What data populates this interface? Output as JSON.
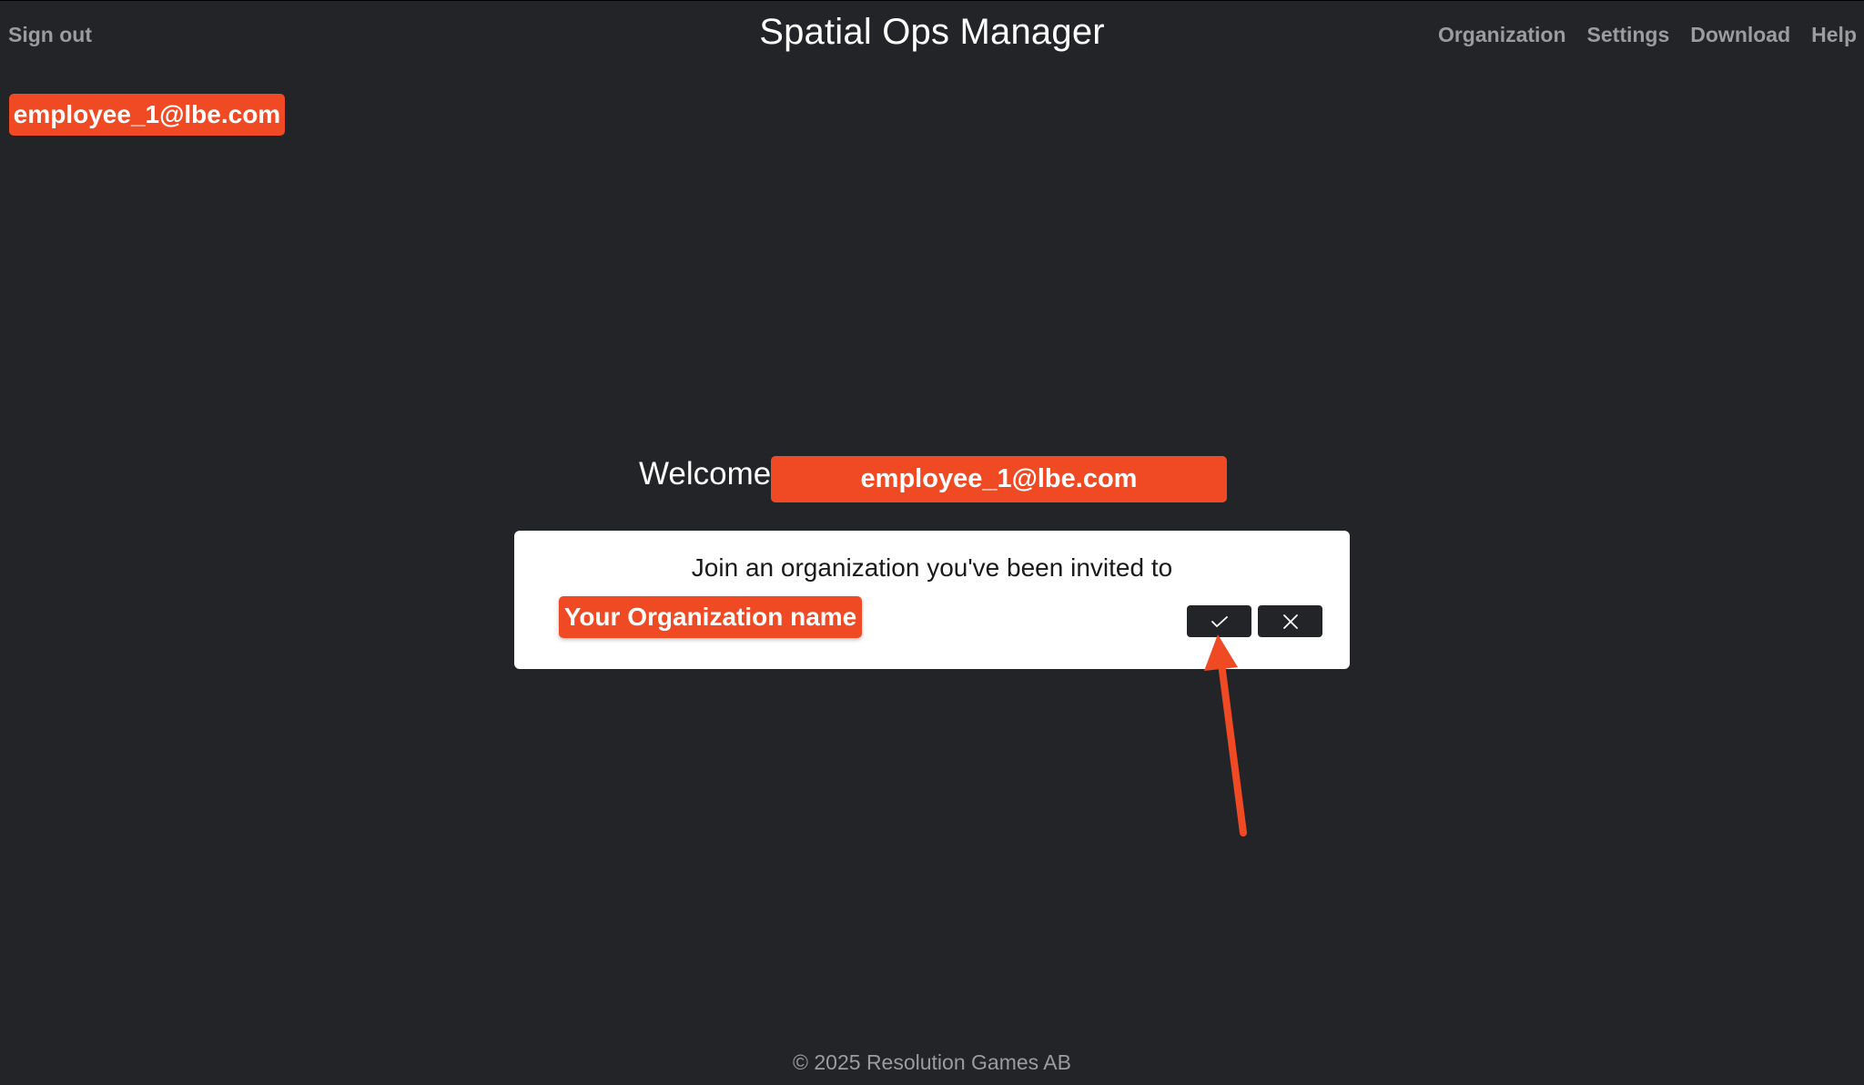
{
  "header": {
    "sign_out_label": "Sign out",
    "app_title": "Spatial Ops Manager",
    "nav": [
      "Organization",
      "Settings",
      "Download",
      "Help"
    ]
  },
  "user": {
    "email_chip": "employee_1@lbe.com"
  },
  "welcome": {
    "label": "Welcome",
    "email": "employee_1@lbe.com"
  },
  "invite": {
    "title": "Join an organization you've been invited to",
    "organization_name": "Your Organization name",
    "accept_icon": "check-icon",
    "decline_icon": "close-icon"
  },
  "footer": {
    "copyright": "© 2025 Resolution Games AB"
  },
  "colors": {
    "background": "#222428",
    "accent": "#f04a24",
    "nav_text": "#9a9ca0",
    "card": "#ffffff"
  }
}
